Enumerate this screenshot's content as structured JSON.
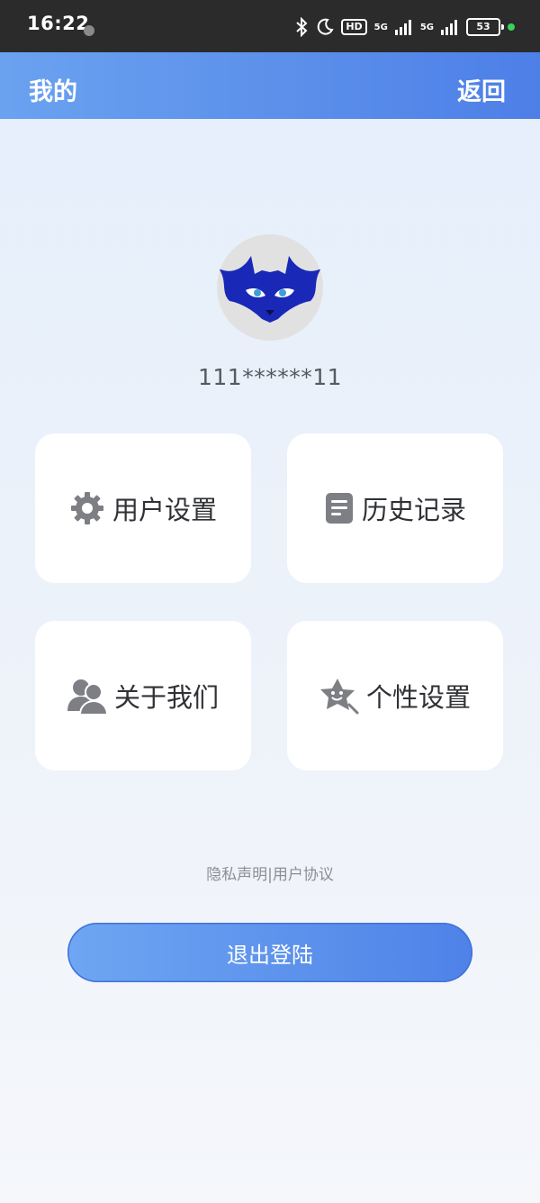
{
  "status_bar": {
    "time": "16:22",
    "hd_badge": "HD",
    "network_1": "5G",
    "network_2": "5G",
    "battery": "53",
    "icons": [
      "tiktok-icon",
      "bluetooth-icon",
      "moon-icon",
      "signal-icon",
      "signal-icon",
      "battery-icon"
    ]
  },
  "header": {
    "title": "我的",
    "back_label": "返回"
  },
  "profile": {
    "avatar_icon": "bat-avatar-icon",
    "username": "111******11"
  },
  "menu": {
    "items": [
      {
        "label": "用户设置",
        "icon": "gear-icon"
      },
      {
        "label": "历史记录",
        "icon": "document-icon"
      },
      {
        "label": "关于我们",
        "icon": "users-icon"
      },
      {
        "label": "个性设置",
        "icon": "star-face-icon"
      }
    ]
  },
  "footer": {
    "links": "隐私声明|用户协议",
    "logout_label": "退出登陆"
  },
  "colors": {
    "accent": "#5b8fea",
    "card_bg": "#ffffff",
    "avatar_bat": "#1a28b8"
  }
}
